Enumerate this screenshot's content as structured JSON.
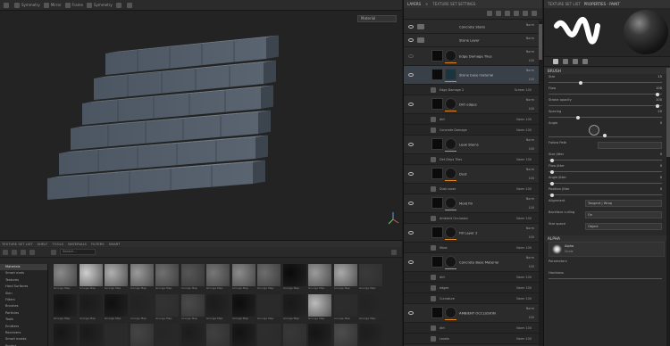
{
  "app": {
    "viewport_mode": "Material"
  },
  "toolbar": {
    "items": [
      "",
      "Symmetry",
      "Mirror",
      "Frame",
      "Symmetry",
      "",
      ""
    ]
  },
  "shelf": {
    "tabs": [
      "TEXTURE SET LIST",
      "SHELF",
      "TOOLS",
      "MATERIALS",
      "FILTERS",
      "SMART"
    ],
    "search_placeholder": "Search...",
    "categories": [
      "Materials",
      "Smart mats",
      "Textures",
      "Hard Surfaces",
      "Skin",
      "Filters",
      "Brushes",
      "Particles",
      "Tools",
      "Emitters",
      "Receivers",
      "Smart masks",
      "Project"
    ],
    "selected_category": 0,
    "thumbs": [
      {
        "c": "#8a8a8a",
        "l": "Grunge Map"
      },
      {
        "c": "#cfcfcf",
        "l": "Grunge Map"
      },
      {
        "c": "#b0b0b0",
        "l": "Grunge Map"
      },
      {
        "c": "#9a9a9a",
        "l": "Grunge Map"
      },
      {
        "c": "#707070",
        "l": "Grunge Map"
      },
      {
        "c": "#565656",
        "l": "Grunge Map"
      },
      {
        "c": "#777777",
        "l": "Grunge Map"
      },
      {
        "c": "#8b8b8b",
        "l": "Grunge Map"
      },
      {
        "c": "#6d6d6d",
        "l": "Grunge Map"
      },
      {
        "c": "#0a0a0a",
        "l": "Grunge Map"
      },
      {
        "c": "#9c9c9c",
        "l": "Grunge Map"
      },
      {
        "c": "#aaaaaa",
        "l": "Grunge Map"
      },
      {
        "c": "#3a3a3a",
        "l": "Grunge Map"
      },
      {
        "c": "#111111",
        "l": "Grunge Map"
      },
      {
        "c": "#1a1a1a",
        "l": "Grunge Map"
      },
      {
        "c": "#0f0f0f",
        "l": "Grunge Map"
      },
      {
        "c": "#222222",
        "l": "Grunge Map"
      },
      {
        "c": "#333333",
        "l": "Grunge Map"
      },
      {
        "c": "#4a4a4a",
        "l": "Grunge Map"
      },
      {
        "c": "#1b1b1b",
        "l": "Grunge Map"
      },
      {
        "c": "#0c0c0c",
        "l": "Grunge Map"
      },
      {
        "c": "#2a2a2a",
        "l": "Grunge Map"
      },
      {
        "c": "#181818",
        "l": "Grunge Map"
      },
      {
        "c": "#bcbcbc",
        "l": "Grunge Map"
      },
      {
        "c": "#2c2c2c",
        "l": "Grunge Map"
      },
      {
        "c": "#222222",
        "l": "Grunge Map"
      },
      {
        "c": "#161616",
        "l": "Grunge Map"
      },
      {
        "c": "#191919",
        "l": "Grunge Map"
      },
      {
        "c": "#2a2a2a",
        "l": "Grunge Map"
      },
      {
        "c": "#454545",
        "l": "Grunge Map"
      },
      {
        "c": "#262626",
        "l": "Grunge Map"
      },
      {
        "c": "#1c1c1c",
        "l": "Grunge Map"
      },
      {
        "c": "#404040",
        "l": "Grunge Map"
      },
      {
        "c": "#121212",
        "l": "Grunge Map"
      },
      {
        "c": "#2e2e2e",
        "l": "Grunge Map"
      },
      {
        "c": "#383838",
        "l": "Grunge Map"
      },
      {
        "c": "#141414",
        "l": "Grunge Map"
      },
      {
        "c": "#4d4d4d",
        "l": "Grunge Map"
      },
      {
        "c": "#1d1d1d",
        "l": "Grunge Map"
      }
    ]
  },
  "layers": {
    "tabs": [
      "LAYERS",
      "TEXTURE SET SETTINGS"
    ],
    "rows": [
      {
        "type": "group",
        "eye": true,
        "name": "Concrete Stairs",
        "blend": "Norm",
        "opacity": "100"
      },
      {
        "type": "group",
        "eye": true,
        "name": "Stone Layer",
        "blend": "Norm",
        "opacity": "100"
      },
      {
        "type": "main",
        "eye": false,
        "name": "Edge Damage Tiles",
        "blend": "Norm",
        "opacity": "100"
      },
      {
        "type": "main",
        "eye": true,
        "name": "Stone base material",
        "blend": "Norm",
        "opacity": "100",
        "sel": true,
        "mask": "sq"
      },
      {
        "type": "sub",
        "name": "Edge Damage 2",
        "blend": "Screen 100"
      },
      {
        "type": "main",
        "eye": true,
        "name": "Dirt edges",
        "blend": "Norm",
        "opacity": "100"
      },
      {
        "type": "sub",
        "name": "dirt",
        "blend": "Norm 100"
      },
      {
        "type": "sub",
        "name": "Concrete Damage",
        "blend": "Norm 100"
      },
      {
        "type": "main",
        "eye": true,
        "name": "Leak Stains",
        "blend": "Norm",
        "opacity": "100"
      },
      {
        "type": "sub",
        "name": "Dirt Drips Tiles",
        "blend": "Norm 100"
      },
      {
        "type": "main",
        "eye": true,
        "name": "Dust",
        "blend": "Norm",
        "opacity": "100"
      },
      {
        "type": "sub",
        "name": "Dust cover",
        "blend": "Norm 100"
      },
      {
        "type": "main",
        "eye": true,
        "name": "Mold fill",
        "blend": "Norm",
        "opacity": "100"
      },
      {
        "type": "sub",
        "name": "Ambient Occlusion",
        "blend": "Norm 100"
      },
      {
        "type": "main",
        "eye": true,
        "name": "Fill Layer 2",
        "blend": "Norm",
        "opacity": "100"
      },
      {
        "type": "sub",
        "name": "Moss",
        "blend": "Norm 100"
      },
      {
        "type": "main",
        "eye": true,
        "name": "Concrete Base Material",
        "blend": "Norm",
        "opacity": "100"
      },
      {
        "type": "sub",
        "name": "dirt",
        "blend": "Norm 100"
      },
      {
        "type": "sub",
        "name": "edges",
        "blend": "Norm 100"
      },
      {
        "type": "sub",
        "name": "Curvature",
        "blend": "Norm 100"
      },
      {
        "type": "main",
        "eye": true,
        "name": "AMBIENT OCCLUSION",
        "blend": "Norm",
        "opacity": "100"
      },
      {
        "type": "sub",
        "name": "dirt",
        "blend": "Norm 100"
      },
      {
        "type": "sub",
        "name": "Levels",
        "blend": "Norm 100"
      }
    ]
  },
  "props": {
    "tabs": [
      "TEXTURE SET LIST",
      "PROPERTIES - PAINT"
    ],
    "section": "BRUSH",
    "rows": [
      {
        "label": "Size",
        "value": "15",
        "pos": 0.28
      },
      {
        "label": "Flow",
        "value": "100",
        "pos": 0.98
      },
      {
        "label": "Stroke opacity",
        "value": "100",
        "pos": 0.98
      },
      {
        "label": "Spacing",
        "value": "25",
        "pos": 0.25
      },
      {
        "label": "Angle",
        "value": "0",
        "pos": 0.5
      },
      {
        "label": "Follow Path",
        "value": "",
        "pos": null
      },
      {
        "label": "Size Jitter",
        "value": "0",
        "pos": 0.02
      },
      {
        "label": "Flow Jitter",
        "value": "0",
        "pos": 0.02
      },
      {
        "label": "Angle Jitter",
        "value": "0",
        "pos": 0.02
      },
      {
        "label": "Position Jitter",
        "value": "0",
        "pos": 0.02
      },
      {
        "label": "Alignment",
        "value": "",
        "drop": "Tangent | Wrap"
      },
      {
        "label": "Backface culling",
        "value": "",
        "drop": "On"
      },
      {
        "label": "Size space",
        "value": "",
        "drop": "Object"
      }
    ],
    "alpha_section": "ALPHA",
    "alpha_name": "Alpha",
    "alpha_sub": "Circle",
    "params_label": "Parameters",
    "hardness_label": "Hardness"
  }
}
